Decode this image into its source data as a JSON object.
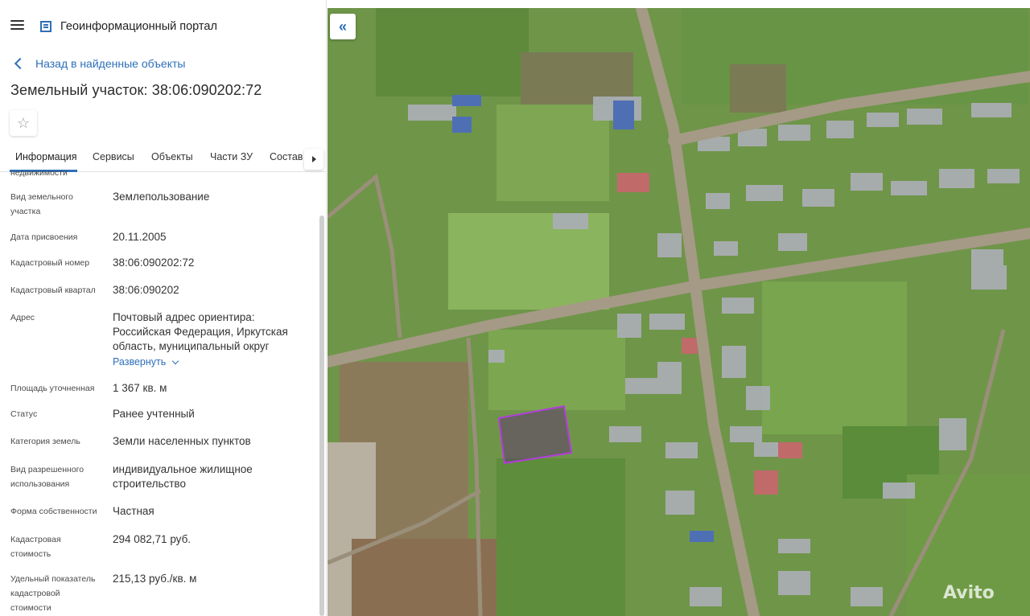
{
  "app": {
    "title": "Геоинформационный портал"
  },
  "nav": {
    "back_label": "Назад в найденные объекты"
  },
  "object": {
    "title": "Земельный участок: 38:06:090202:72"
  },
  "tabs": [
    {
      "label": "Информация",
      "active": true
    },
    {
      "label": "Сервисы"
    },
    {
      "label": "Объекты"
    },
    {
      "label": "Части ЗУ"
    },
    {
      "label": "Состав"
    }
  ],
  "info": {
    "cut_label": "недвижимости",
    "rows": [
      {
        "label": "Вид земельного участка",
        "value": "Землепользование"
      },
      {
        "label": "Дата присвоения",
        "value": "20.11.2005"
      },
      {
        "label": "Кадастровый номер",
        "value": "38:06:090202:72"
      },
      {
        "label": "Кадастровый квартал",
        "value": "38:06:090202"
      },
      {
        "label": "Адрес",
        "value": "Почтовый адрес ориентира: Российская Федерация, Иркутская область, муниципальный округ"
      },
      {
        "label": "Площадь уточненная",
        "value": "1 367 кв. м"
      },
      {
        "label": "Статус",
        "value": "Ранее учтенный"
      },
      {
        "label": "Категория земель",
        "value": "Земли населенных пунктов"
      },
      {
        "label": "Вид разрешенного использования",
        "value": "индивидуальное жилищное строительство"
      },
      {
        "label": "Форма собственности",
        "value": "Частная"
      },
      {
        "label": "Кадастровая стоимость",
        "value": "294 082,71 руб."
      },
      {
        "label": "Удельный показатель кадастровой стоимости",
        "value": "215,13 руб./кв. м"
      }
    ],
    "expand_label": "Развернуть"
  },
  "map": {
    "collapse_icon": "double-chevron-left-icon",
    "parcel_color": "#b43cdc",
    "watermark": "Avito"
  },
  "colors": {
    "accent": "#2d6fb8"
  }
}
